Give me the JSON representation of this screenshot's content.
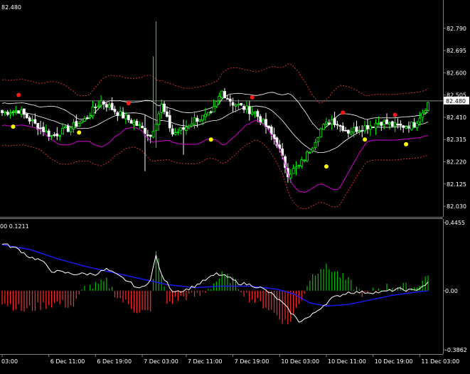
{
  "chart_data": [
    {
      "type": "candlestick",
      "panel": "price",
      "ticker_price": "82.480",
      "current_price_label": "82.480",
      "current_price": 82.48,
      "ylim": [
        82.0,
        82.85
      ],
      "y_ticks": [
        {
          "value": 82.79,
          "label": "82.790"
        },
        {
          "value": 82.695,
          "label": "82.695"
        },
        {
          "value": 82.6,
          "label": "82.600"
        },
        {
          "value": 82.505,
          "label": "82.505"
        },
        {
          "value": 82.41,
          "label": "82.410"
        },
        {
          "value": 82.315,
          "label": "82.315"
        },
        {
          "value": 82.22,
          "label": "82.220"
        },
        {
          "value": 82.125,
          "label": "82.125"
        },
        {
          "value": 82.03,
          "label": "82.030"
        }
      ],
      "close_keys": [
        [
          0,
          82.43
        ],
        [
          6,
          82.44
        ],
        [
          12,
          82.38
        ],
        [
          18,
          82.33
        ],
        [
          24,
          82.36
        ],
        [
          30,
          82.4
        ],
        [
          36,
          82.48
        ],
        [
          42,
          82.43
        ],
        [
          46,
          82.4
        ],
        [
          50,
          82.37
        ],
        [
          54,
          82.33
        ],
        [
          58,
          82.46
        ],
        [
          62,
          82.34
        ],
        [
          66,
          82.36
        ],
        [
          70,
          82.4
        ],
        [
          76,
          82.42
        ],
        [
          80,
          82.52
        ],
        [
          84,
          82.47
        ],
        [
          88,
          82.45
        ],
        [
          92,
          82.43
        ],
        [
          96,
          82.37
        ],
        [
          100,
          82.3
        ],
        [
          104,
          82.17
        ],
        [
          108,
          82.2
        ],
        [
          112,
          82.27
        ],
        [
          116,
          82.36
        ],
        [
          120,
          82.4
        ],
        [
          126,
          82.35
        ],
        [
          132,
          82.37
        ],
        [
          138,
          82.39
        ],
        [
          144,
          82.37
        ],
        [
          150,
          82.38
        ],
        [
          155,
          82.47
        ]
      ],
      "spikes": [
        {
          "index": 56,
          "high": 82.82,
          "low": 82.28
        },
        {
          "index": 55,
          "high": 82.67,
          "low": 82.32
        },
        {
          "index": 52,
          "high": 82.42,
          "low": 82.18
        },
        {
          "index": 66,
          "high": 82.4,
          "low": 82.25
        }
      ],
      "red_dots": [
        {
          "index": 6,
          "value": 82.505
        },
        {
          "index": 46,
          "value": 82.47
        },
        {
          "index": 91,
          "value": 82.495
        },
        {
          "index": 124,
          "value": 82.43
        },
        {
          "index": 143,
          "value": 82.42
        }
      ],
      "yellow_dots": [
        {
          "index": 4,
          "value": 82.37
        },
        {
          "index": 28,
          "value": 82.345
        },
        {
          "index": 76,
          "value": 82.315
        },
        {
          "index": 118,
          "value": 82.2
        },
        {
          "index": 132,
          "value": 82.315
        },
        {
          "index": 147,
          "value": 82.295
        }
      ],
      "colors": {
        "bull_candle": "#00ff00",
        "bear_candle": "#ffffff",
        "bull_candle_body": "#000000",
        "bear_candle_body": "#ffffff",
        "bb_middle": "#ffffff",
        "bb_band": "#ffffff",
        "envelope": "#ff3b3b",
        "lower_line": "#d100d1",
        "red_dot": "#ff1a1a",
        "yellow_dot": "#ffff00",
        "price_line": "#8a8a8a"
      }
    },
    {
      "type": "histogram+line",
      "panel": "oscillator",
      "header_text": "00 0.1211",
      "ylim": [
        -0.3862,
        0.4455
      ],
      "y_ticks": [
        {
          "value": 0.4455,
          "label": "0.4455"
        },
        {
          "value": 0.0,
          "label": "0.00"
        },
        {
          "value": -0.3862,
          "label": "-0.3862"
        }
      ],
      "hist_keys": [
        [
          0,
          -0.07
        ],
        [
          8,
          -0.13
        ],
        [
          14,
          -0.1
        ],
        [
          20,
          -0.08
        ],
        [
          26,
          -0.1
        ],
        [
          30,
          0.02
        ],
        [
          34,
          0.03
        ],
        [
          38,
          0.06
        ],
        [
          42,
          -0.04
        ],
        [
          48,
          -0.12
        ],
        [
          54,
          -0.15
        ],
        [
          56,
          0.28
        ],
        [
          60,
          -0.08
        ],
        [
          66,
          -0.04
        ],
        [
          72,
          -0.03
        ],
        [
          76,
          0.03
        ],
        [
          80,
          0.1
        ],
        [
          84,
          0.07
        ],
        [
          90,
          -0.05
        ],
        [
          96,
          -0.1
        ],
        [
          100,
          -0.16
        ],
        [
          104,
          -0.22
        ],
        [
          108,
          -0.09
        ],
        [
          112,
          0.08
        ],
        [
          116,
          0.16
        ],
        [
          120,
          0.14
        ],
        [
          126,
          0.06
        ],
        [
          132,
          -0.03
        ],
        [
          138,
          0.02
        ],
        [
          144,
          0.03
        ],
        [
          150,
          0.02
        ],
        [
          155,
          0.1
        ]
      ],
      "fast_keys": [
        [
          0,
          0.31
        ],
        [
          6,
          0.27
        ],
        [
          10,
          0.22
        ],
        [
          14,
          0.2
        ],
        [
          18,
          0.13
        ],
        [
          22,
          0.12
        ],
        [
          26,
          0.11
        ],
        [
          30,
          0.11
        ],
        [
          34,
          0.11
        ],
        [
          38,
          0.14
        ],
        [
          42,
          0.1
        ],
        [
          46,
          0.06
        ],
        [
          50,
          0.01
        ],
        [
          54,
          0.07
        ],
        [
          56,
          0.23
        ],
        [
          58,
          0.1
        ],
        [
          62,
          0.0
        ],
        [
          66,
          0.0
        ],
        [
          70,
          0.03
        ],
        [
          74,
          0.07
        ],
        [
          78,
          0.11
        ],
        [
          82,
          0.09
        ],
        [
          86,
          0.05
        ],
        [
          90,
          0.04
        ],
        [
          94,
          0.02
        ],
        [
          98,
          -0.02
        ],
        [
          102,
          -0.08
        ],
        [
          106,
          -0.16
        ],
        [
          108,
          -0.2
        ],
        [
          112,
          -0.17
        ],
        [
          116,
          -0.11
        ],
        [
          120,
          -0.05
        ],
        [
          126,
          -0.01
        ],
        [
          132,
          -0.01
        ],
        [
          138,
          -0.01
        ],
        [
          144,
          0.01
        ],
        [
          150,
          0.0
        ],
        [
          155,
          0.05
        ]
      ],
      "signal_keys": [
        [
          0,
          0.3
        ],
        [
          10,
          0.27
        ],
        [
          20,
          0.21
        ],
        [
          30,
          0.16
        ],
        [
          40,
          0.12
        ],
        [
          50,
          0.08
        ],
        [
          60,
          0.04
        ],
        [
          70,
          0.02
        ],
        [
          80,
          0.03
        ],
        [
          90,
          0.03
        ],
        [
          100,
          0.01
        ],
        [
          106,
          -0.02
        ],
        [
          112,
          -0.08
        ],
        [
          118,
          -0.1
        ],
        [
          126,
          -0.09
        ],
        [
          134,
          -0.06
        ],
        [
          142,
          -0.03
        ],
        [
          150,
          -0.01
        ],
        [
          155,
          0.0
        ]
      ],
      "colors": {
        "hist_up": "#00c000",
        "hist_down": "#ff2a2a",
        "fast_line": "#ffffff",
        "signal_line": "#1a1aff"
      }
    },
    {
      "type": "time_axis",
      "labels": [
        {
          "index": 0,
          "label": "03:00"
        },
        {
          "index": 17,
          "label": "6 Dec 11:00"
        },
        {
          "index": 34,
          "label": "6 Dec 19:00"
        },
        {
          "index": 51,
          "label": "7 Dec 03:00"
        },
        {
          "index": 67,
          "label": "7 Dec 11:00"
        },
        {
          "index": 84,
          "label": "7 Dec 19:00"
        },
        {
          "index": 101,
          "label": "10 Dec 03:00"
        },
        {
          "index": 118,
          "label": "10 Dec 11:00"
        },
        {
          "index": 135,
          "label": "10 Dec 19:00"
        },
        {
          "index": 152,
          "label": "11 Dec 03:00"
        }
      ],
      "bar_count": 156
    }
  ]
}
